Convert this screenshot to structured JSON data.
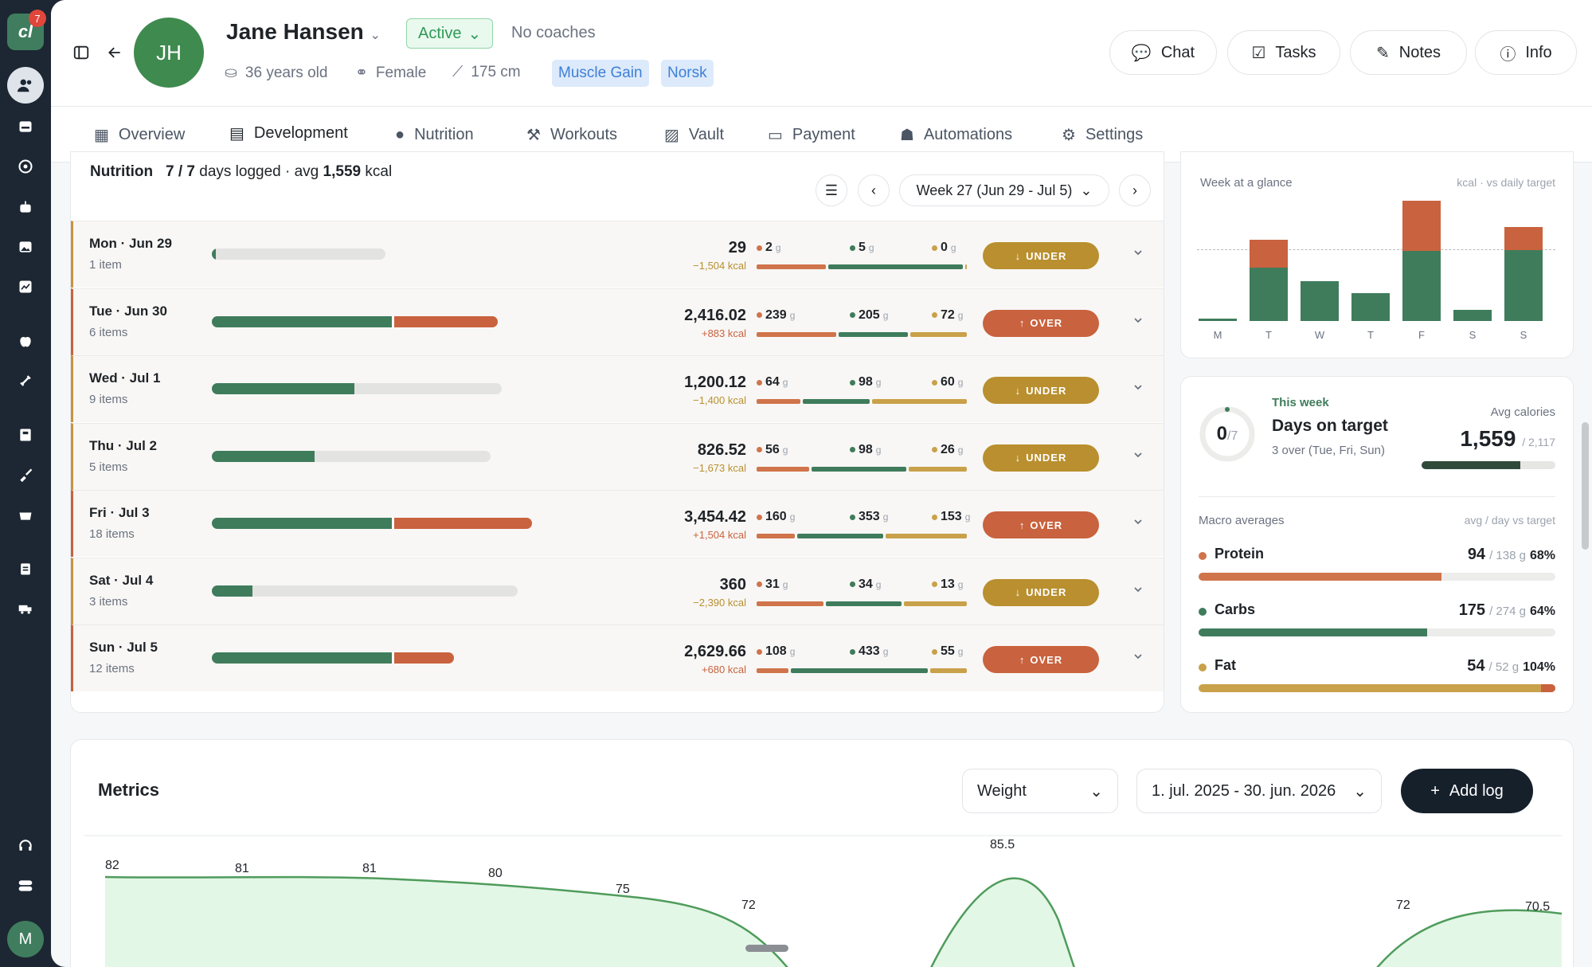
{
  "rail": {
    "badge": "7",
    "avatar": "M"
  },
  "client": {
    "initials": "JH",
    "name": "Jane Hansen",
    "status": "Active",
    "coaches": "No coaches",
    "age": "36 years old",
    "gender": "Female",
    "height": "175 cm",
    "tags": [
      "Muscle Gain",
      "Norsk"
    ]
  },
  "header_buttons": {
    "chat": "Chat",
    "tasks": "Tasks",
    "notes": "Notes",
    "info": "Info"
  },
  "tabs": [
    "Overview",
    "Development",
    "Nutrition",
    "Workouts",
    "Vault",
    "Payment",
    "Automations",
    "Settings"
  ],
  "nutrition": {
    "title": "Nutrition",
    "logged": "7 / 7",
    "logged_suffix": "days logged · avg",
    "avg": "1,559",
    "unit": "kcal",
    "week": "Week 27 (Jun 29 - Jul 5)",
    "rows": [
      {
        "day": "Mon · Jun 29",
        "items": "1 item",
        "kcal": "29",
        "delta": "−1,504 kcal",
        "status": "UNDER",
        "p": "2",
        "c": "5",
        "f": "0",
        "fill": 0.0137,
        "extra": 0,
        "pw": 0.33,
        "cw": 0.64,
        "fw": 0.1
      },
      {
        "day": "Tue · Jun 30",
        "items": "6 items",
        "kcal": "2,416.02",
        "delta": "+883 kcal",
        "status": "OVER",
        "p": "239",
        "c": "205",
        "f": "72",
        "fill": 0.58,
        "extra": 0.34,
        "pw": 0.38,
        "cw": 0.33,
        "fw": 0.26
      },
      {
        "day": "Wed · Jul 1",
        "items": "9 items",
        "kcal": "1,200.12",
        "delta": "−1,400 kcal",
        "status": "UNDER",
        "p": "64",
        "c": "98",
        "f": "60",
        "fill": 0.46,
        "extra": 0,
        "pw": 0.21,
        "cw": 0.32,
        "fw": 0.44
      },
      {
        "day": "Thu · Jul 2",
        "items": "5 items",
        "kcal": "826.52",
        "delta": "−1,673 kcal",
        "status": "UNDER",
        "p": "56",
        "c": "98",
        "f": "26",
        "fill": 0.33,
        "extra": 0,
        "pw": 0.25,
        "cw": 0.45,
        "fw": 0.27
      },
      {
        "day": "Fri · Jul 3",
        "items": "18 items",
        "kcal": "3,454.42",
        "delta": "+1,504 kcal",
        "status": "OVER",
        "p": "160",
        "c": "353",
        "f": "153",
        "fill": 0.58,
        "extra": 0.45,
        "pw": 0.18,
        "cw": 0.41,
        "fw": 0.38
      },
      {
        "day": "Sat · Jul 4",
        "items": "3 items",
        "kcal": "360",
        "delta": "−2,390 kcal",
        "status": "UNDER",
        "p": "31",
        "c": "34",
        "f": "13",
        "fill": 0.13,
        "extra": 0,
        "pw": 0.32,
        "cw": 0.36,
        "fw": 0.29
      },
      {
        "day": "Sun · Jul 5",
        "items": "12 items",
        "kcal": "2,629.66",
        "delta": "+680 kcal",
        "status": "OVER",
        "p": "108",
        "c": "433",
        "f": "55",
        "fill": 0.58,
        "extra": 0.2,
        "pw": 0.15,
        "cw": 0.65,
        "fw": 0.17
      }
    ]
  },
  "glance": {
    "title": "Week at a glance",
    "subtitle": "kcal · vs daily target",
    "days": [
      "M",
      "T",
      "W",
      "T",
      "F",
      "S",
      "S"
    ],
    "base": [
      0.02,
      0.48,
      0.36,
      0.25,
      0.63,
      0.1,
      0.63
    ],
    "over": [
      0,
      0.25,
      0,
      0,
      0.45,
      0,
      0.21
    ]
  },
  "target": {
    "ring_value": "0",
    "ring_total": "/7",
    "this_week": "This week",
    "title": "Days on target",
    "sub": "3 over (Tue, Fri, Sun)",
    "avg_label": "Avg calories",
    "avg_value": "1,559",
    "avg_target": "/ 2,117",
    "avg_fill": 0.74
  },
  "macros": {
    "title": "Macro averages",
    "subtitle": "avg / day vs target",
    "items": [
      {
        "name": "Protein",
        "value": "94",
        "target": "/ 138 g",
        "pct": "68%",
        "fill": 0.68,
        "color": "#d0744b"
      },
      {
        "name": "Carbs",
        "value": "175",
        "target": "/ 274 g",
        "pct": "64%",
        "fill": 0.64,
        "color": "#3f7c5c"
      },
      {
        "name": "Fat",
        "value": "54",
        "target": "/ 52 g",
        "pct": "104%",
        "fill": 1.0,
        "color": "#c9a14a"
      }
    ]
  },
  "metrics": {
    "title": "Metrics",
    "metric": "Weight",
    "range": "1. jul. 2025 - 30. jun. 2026",
    "add": "Add log",
    "labels": [
      "82",
      "81",
      "81",
      "80",
      "75",
      "72",
      "85.5",
      "72",
      "70.5"
    ]
  },
  "colors": {
    "green": "#3f7c5c",
    "red": "#c9623e",
    "gold": "#b98f2f",
    "protein": "#d0744b",
    "fat": "#c9a14a"
  }
}
